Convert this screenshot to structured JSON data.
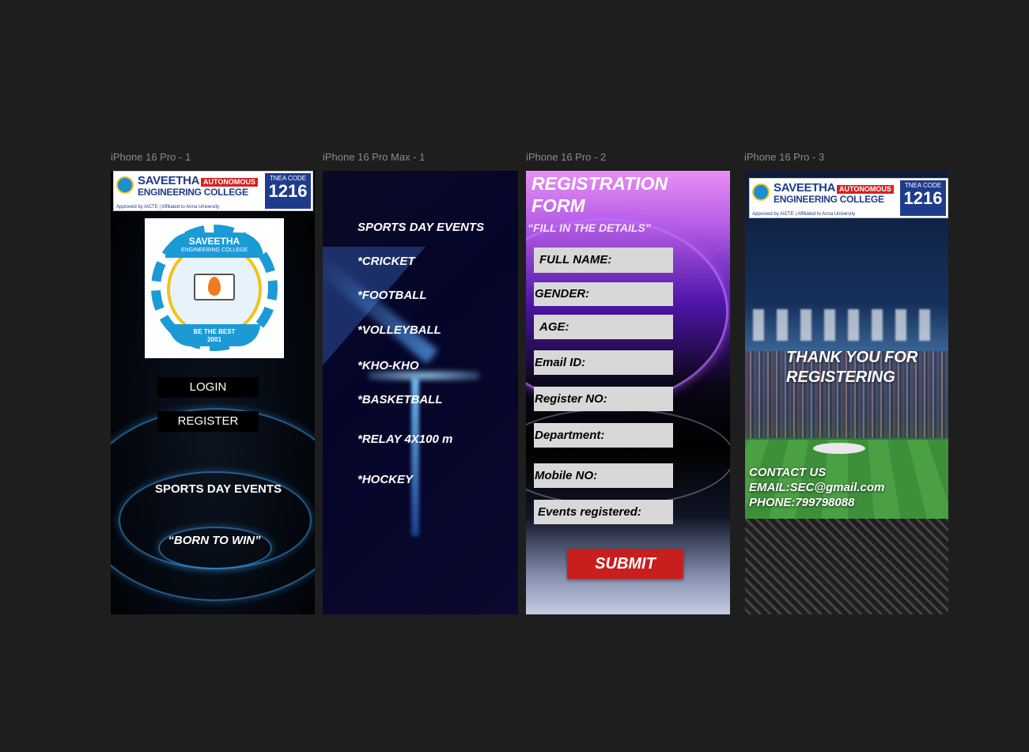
{
  "frames": [
    {
      "label": "iPhone 16 Pro - 1"
    },
    {
      "label": "iPhone 16 Pro Max - 1"
    },
    {
      "label": "iPhone 16 Pro - 2"
    },
    {
      "label": "iPhone 16 Pro - 3"
    }
  ],
  "banner": {
    "name_line1": "SAVEETHA",
    "name_line2": "ENGINEERING COLLEGE",
    "autonomous": "AUTONOMOUS",
    "tnea_label": "TNEA CODE",
    "tnea_code": "1216",
    "approval": "Approved by AICTE | Affiliated to Anna University"
  },
  "home": {
    "logo_name": "SAVEETHA",
    "logo_sub": "ENGINEERING COLLEGE",
    "logo_motto": "BE THE BEST",
    "logo_year": "2001",
    "login_label": "LOGIN",
    "register_label": "REGISTER",
    "events_title": "SPORTS DAY EVENTS",
    "tagline": "“BORN TO WIN”"
  },
  "events": {
    "title": "SPORTS DAY EVENTS",
    "items": [
      "*CRICKET",
      "*FOOTBALL",
      "*VOLLEYBALL",
      "*KHO-KHO",
      "*BASKETBALL",
      "*RELAY 4X100 m",
      "*HOCKEY"
    ]
  },
  "form": {
    "title_line1": "REGISTRATION",
    "title_line2": "FORM",
    "subtitle": "“FILL IN THE DETAILS”",
    "fields": [
      "FULL NAME:",
      "GENDER:",
      "AGE:",
      "Email ID:",
      "Register NO:",
      "Department:",
      "Mobile NO:",
      "Events registered:"
    ],
    "submit_label": "SUBMIT"
  },
  "thanks": {
    "line1": "THANK YOU FOR",
    "line2": "REGISTERING",
    "contact_title": "CONTACT US",
    "email": "EMAIL:SEC@gmail.com",
    "phone": "PHONE:799798088"
  }
}
